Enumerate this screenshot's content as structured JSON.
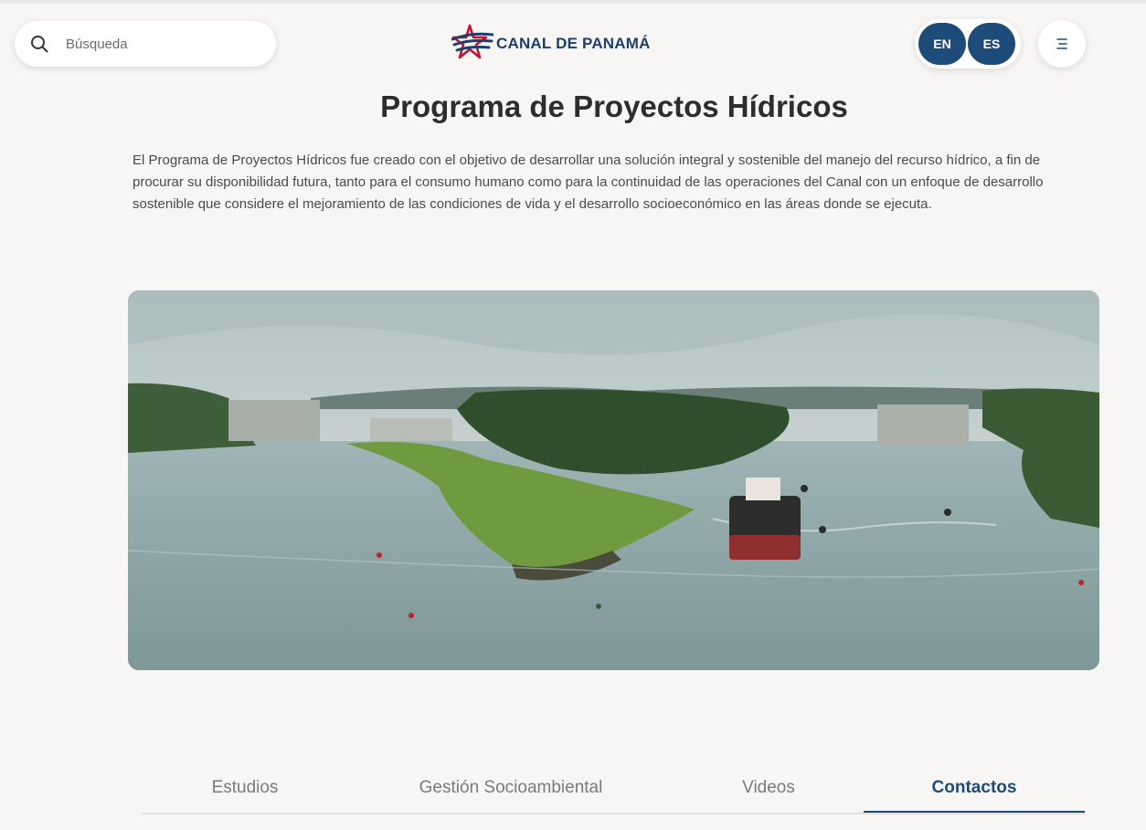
{
  "search": {
    "placeholder": "Búsqueda",
    "icon": "search-icon"
  },
  "logo": {
    "text": "CANAL DE PANAMÁ"
  },
  "language": {
    "en_label": "EN",
    "es_label": "ES"
  },
  "menu": {
    "icon": "menu-icon"
  },
  "page": {
    "title": "Programa de Proyectos Hídricos",
    "description": "El Programa de Proyectos Hídricos fue creado con el objetivo de desarrollar una solución integral y sostenible del manejo del recurso hídrico, a fin de procurar su disponibilidad futura, tanto para el consumo humano como para la continuidad de las operaciones del Canal con un enfoque de desarrollo sostenible que considere el mejoramiento de las condiciones de vida y el desarrollo socioeconómico en las áreas donde se ejecuta."
  },
  "tabs": [
    {
      "label": "Estudios"
    },
    {
      "label": "Gestión Socioambiental"
    },
    {
      "label": "Videos"
    },
    {
      "label": "Contactos"
    }
  ],
  "colors": {
    "brand_blue": "#1d4c7a",
    "logo_red": "#c8102e",
    "background": "#f8f5f5"
  }
}
